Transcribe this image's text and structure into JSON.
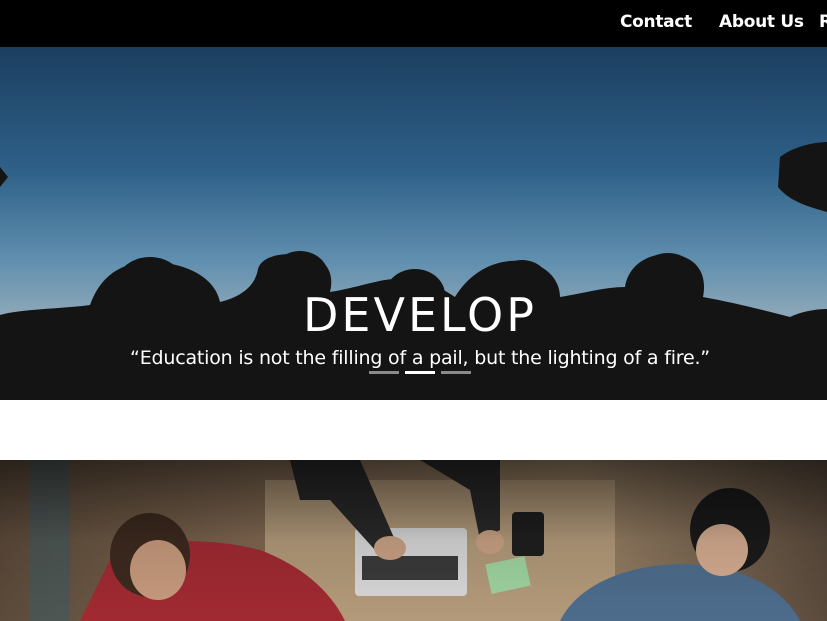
{
  "nav": {
    "items": [
      {
        "label": "Contact"
      },
      {
        "label": "About Us"
      },
      {
        "label": "R"
      }
    ]
  },
  "hero": {
    "title": "DEVELOP",
    "quote": "“Education is not the filling of a pail, but the lighting of a fire.”",
    "slides": [
      {
        "active": false
      },
      {
        "active": true
      },
      {
        "active": false
      }
    ]
  },
  "colors": {
    "topbar": "#000000",
    "text": "#ffffff",
    "indicator_active": "#ffffff",
    "indicator_inactive": "#8a8a8a"
  }
}
